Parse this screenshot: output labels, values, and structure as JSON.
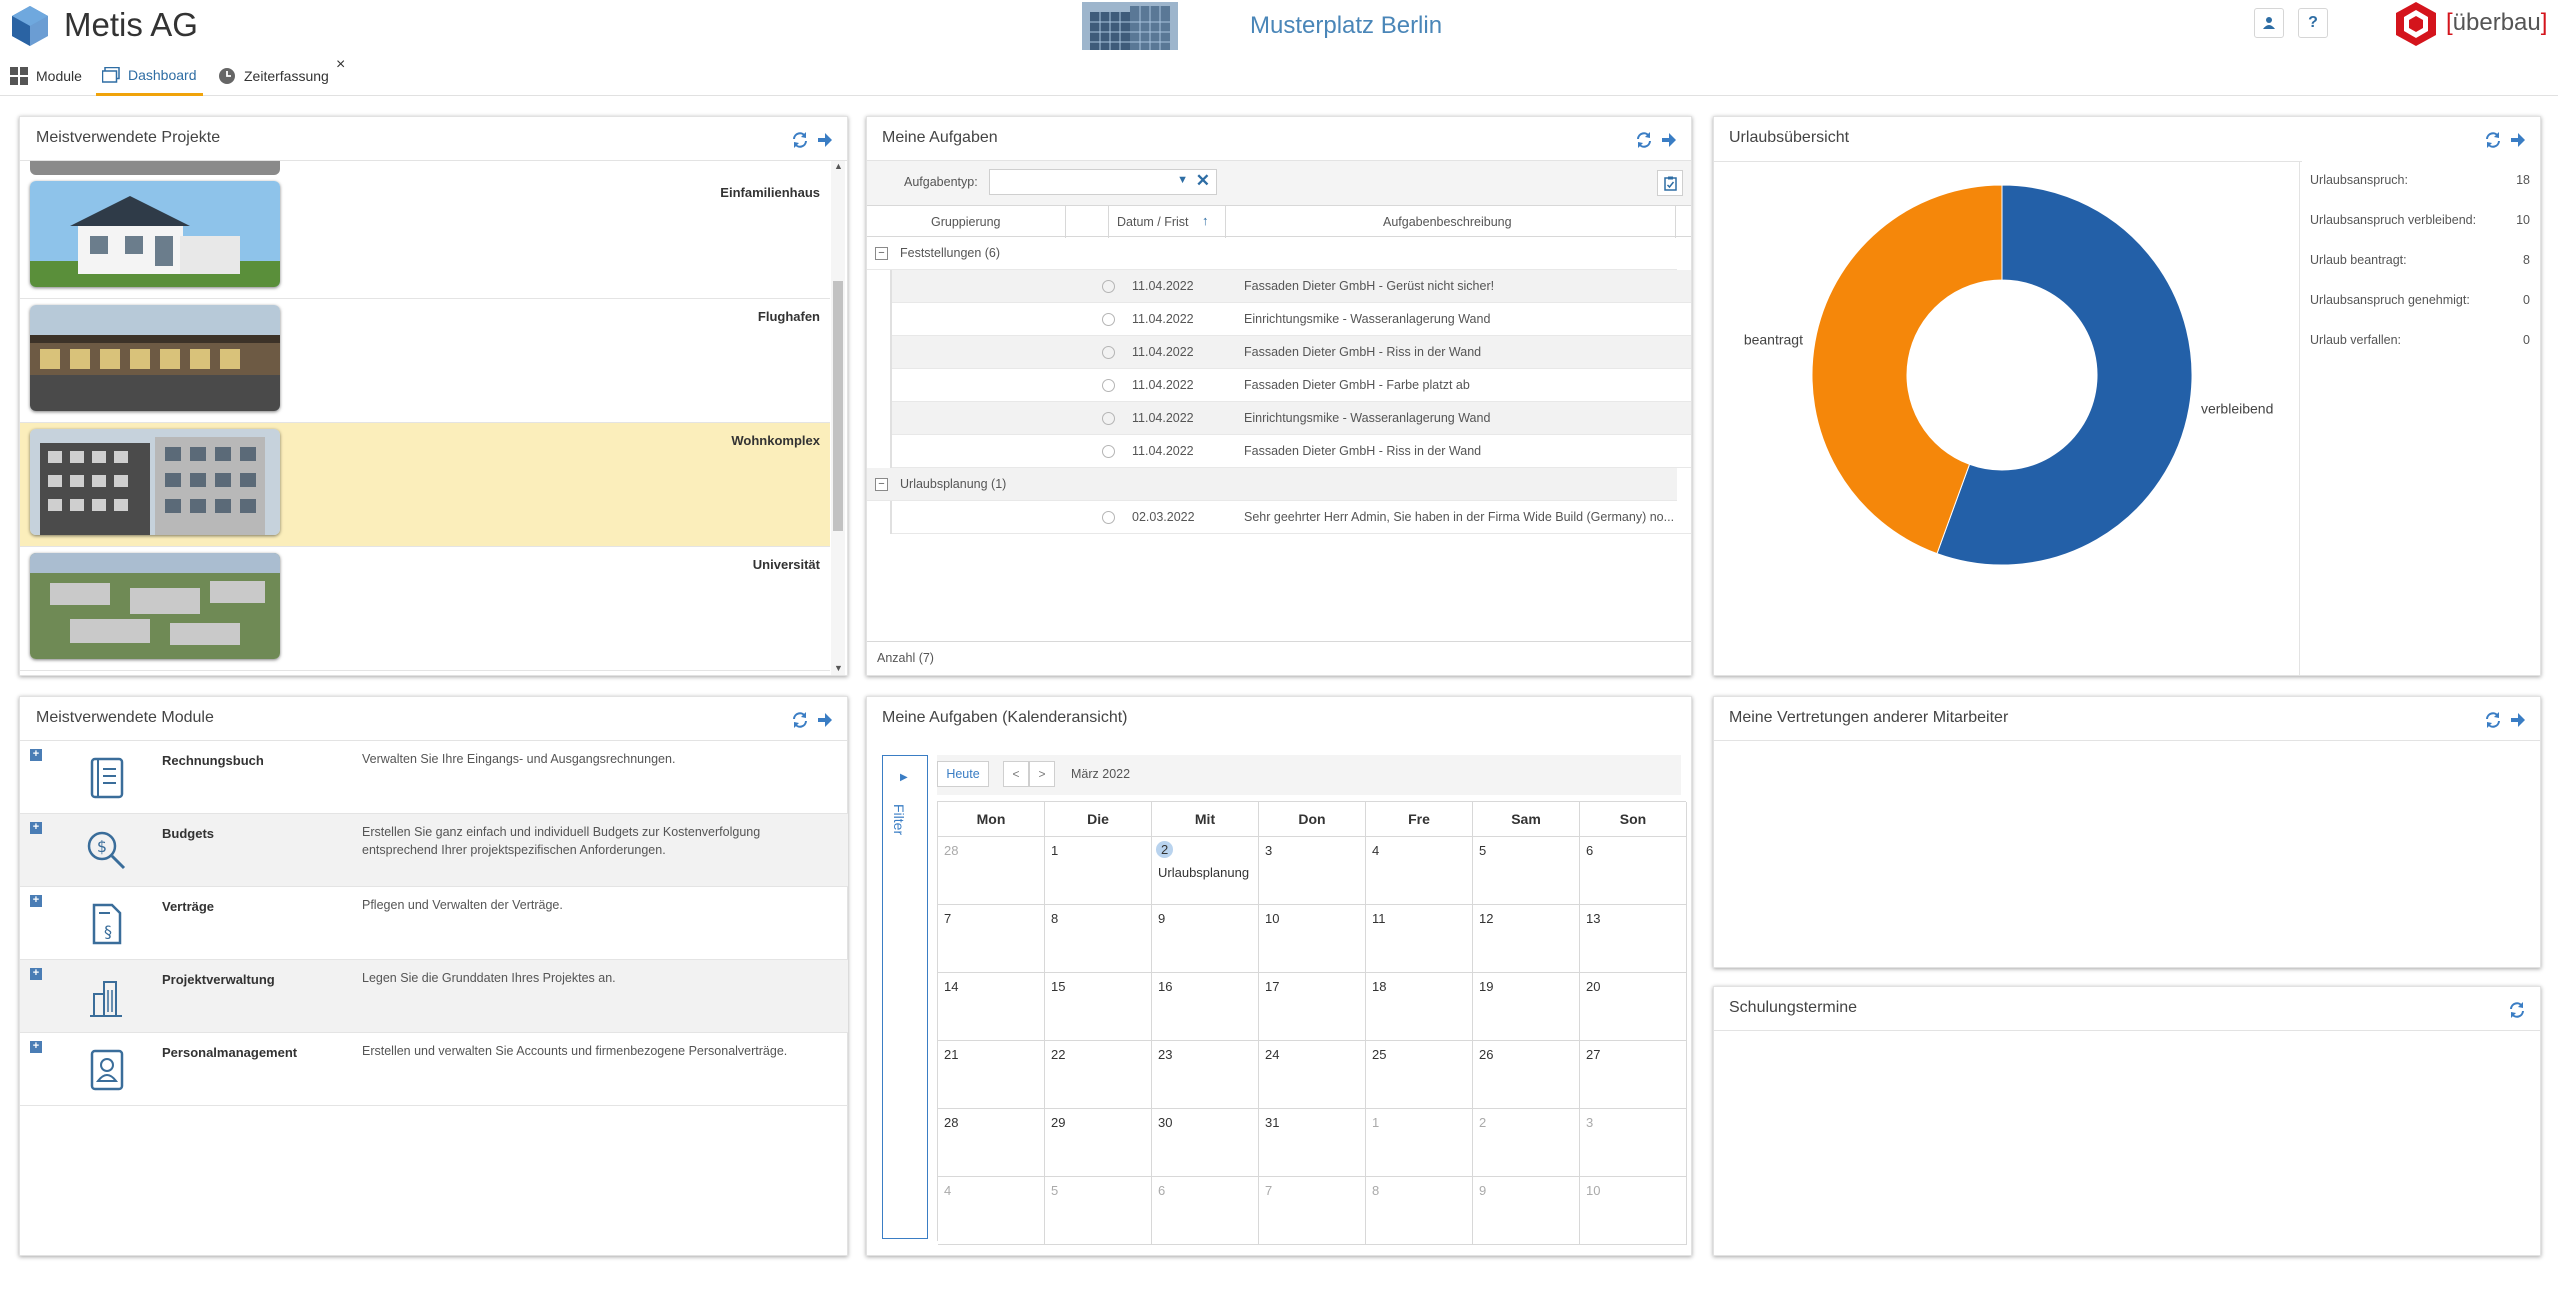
{
  "header": {
    "app_title": "Metis AG",
    "location": "Musterplatz Berlin",
    "brand": "überbau",
    "accent_color": "#4a86b8",
    "brand_color": "#d4141c"
  },
  "nav": {
    "tabs": [
      {
        "label": "Module",
        "icon": "grid-icon"
      },
      {
        "label": "Dashboard",
        "icon": "window-icon"
      },
      {
        "label": "Zeiterfassung",
        "icon": "clock-icon"
      }
    ],
    "close_label": "×"
  },
  "projects": {
    "title": "Meistverwendete Projekte",
    "items": [
      {
        "name": "Einfamilienhaus"
      },
      {
        "name": "Flughafen"
      },
      {
        "name": "Wohnkomplex",
        "highlighted": true
      },
      {
        "name": "Universität"
      }
    ]
  },
  "tasks": {
    "title": "Meine Aufgaben",
    "filter_label": "Aufgabentyp:",
    "filter_value": "",
    "columns": [
      "Gruppierung",
      "Datum / Frist",
      "Aufgabenbeschreibung"
    ],
    "groups": [
      {
        "label": "Feststellungen (6)",
        "rows": [
          {
            "date": "11.04.2022",
            "desc": "Fassaden Dieter GmbH - Gerüst nicht sicher!"
          },
          {
            "date": "11.04.2022",
            "desc": "Einrichtungsmike - Wasseranlagerung Wand"
          },
          {
            "date": "11.04.2022",
            "desc": "Fassaden Dieter GmbH - Riss in der Wand"
          },
          {
            "date": "11.04.2022",
            "desc": "Fassaden Dieter GmbH - Farbe platzt ab"
          },
          {
            "date": "11.04.2022",
            "desc": "Einrichtungsmike - Wasseranlagerung Wand"
          },
          {
            "date": "11.04.2022",
            "desc": "Fassaden Dieter GmbH - Riss in der Wand"
          }
        ]
      },
      {
        "label": "Urlaubsplanung (1)",
        "rows": [
          {
            "date": "02.03.2022",
            "desc": "Sehr geehrter Herr Admin, Sie haben in der Firma Wide Build (Germany) no..."
          }
        ]
      }
    ],
    "count_label": "Anzahl (7)"
  },
  "vacation": {
    "title": "Urlaubsübersicht",
    "stats": [
      {
        "label": "Urlaubsanspruch:",
        "value": "18"
      },
      {
        "label": "Urlaubsanspruch verbleibend:",
        "value": "10"
      },
      {
        "label": "Urlaub beantragt:",
        "value": "8"
      },
      {
        "label": "Urlaubsanspruch genehmigt:",
        "value": "0"
      },
      {
        "label": "Urlaub verfallen:",
        "value": "0"
      }
    ],
    "chart_data": {
      "type": "pie",
      "categories": [
        "verbleibend",
        "beantragt"
      ],
      "values": [
        10,
        8
      ],
      "colors": [
        "#2360a8",
        "#f5870a"
      ]
    }
  },
  "modules": {
    "title": "Meistverwendete Module",
    "items": [
      {
        "name": "Rechnungsbuch",
        "desc": "Verwalten Sie Ihre Eingangs- und Ausgangsrechnungen.",
        "icon": "ledger-icon"
      },
      {
        "name": "Budgets",
        "desc": "Erstellen Sie ganz einfach und individuell Budgets zur Kostenverfolgung entsprechend Ihrer projektspezifischen Anforderungen.",
        "icon": "money-search-icon"
      },
      {
        "name": "Verträge",
        "desc": "Pflegen und Verwalten der Verträge.",
        "icon": "contract-icon"
      },
      {
        "name": "Projektverwaltung",
        "desc": "Legen Sie die Grunddaten Ihres Projektes an.",
        "icon": "buildings-icon"
      },
      {
        "name": "Personalmanagement",
        "desc": "Erstellen und verwalten Sie Accounts und firmenbezogene Personalverträge.",
        "icon": "person-card-icon"
      }
    ]
  },
  "calendar": {
    "title": "Meine Aufgaben (Kalenderansicht)",
    "filter_label": "Filter",
    "today_label": "Heute",
    "prev_label": "<",
    "next_label": ">",
    "month_label": "März 2022",
    "weekdays": [
      "Mon",
      "Die",
      "Mit",
      "Don",
      "Fre",
      "Sam",
      "Son"
    ],
    "days": [
      "28",
      "1",
      "2",
      "3",
      "4",
      "5",
      "6",
      "7",
      "8",
      "9",
      "10",
      "11",
      "12",
      "13",
      "14",
      "15",
      "16",
      "17",
      "18",
      "19",
      "20",
      "21",
      "22",
      "23",
      "24",
      "25",
      "26",
      "27",
      "28",
      "29",
      "30",
      "31",
      "1",
      "2",
      "3",
      "4",
      "5",
      "6",
      "7",
      "8",
      "9",
      "10"
    ],
    "event": {
      "day": "2",
      "label": "Urlaubsplanung"
    }
  },
  "substitutions": {
    "title": "Meine Vertretungen anderer Mitarbeiter"
  },
  "training": {
    "title": "Schulungstermine"
  }
}
